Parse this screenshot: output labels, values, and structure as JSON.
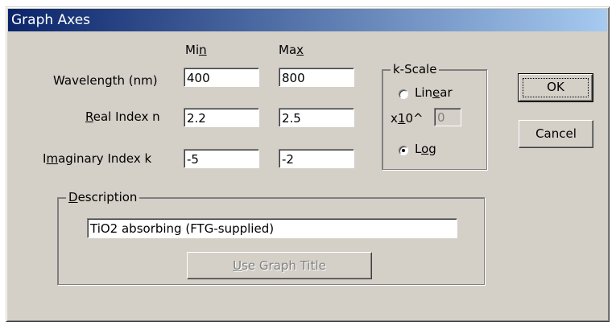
{
  "window": {
    "title": "Graph Axes"
  },
  "headers": {
    "min_pre": "Mi",
    "min_u": "n",
    "max_pre": "Ma",
    "max_u": "x"
  },
  "rows": {
    "wavelength": {
      "label": "Wavelength (nm)",
      "min": "400",
      "max": "800"
    },
    "real": {
      "u": "R",
      "rest": "eal Index n",
      "min": "2.2",
      "max": "2.5"
    },
    "imag": {
      "pre": "I",
      "u": "m",
      "rest": "aginary Index k",
      "min": "-5",
      "max": "-2"
    }
  },
  "kscale": {
    "title": "k-Scale",
    "linear": {
      "pre": "Lin",
      "u": "e",
      "rest": "ar",
      "selected": false
    },
    "x10": {
      "pre": "x",
      "u": "1",
      "rest": "0^",
      "value": "0"
    },
    "log": {
      "pre": "L",
      "u": "o",
      "rest": "g",
      "selected": true
    }
  },
  "description": {
    "title_u": "D",
    "title_rest": "escription",
    "value": "TiO2 absorbing (FTG-supplied)",
    "use_title_button": {
      "u": "U",
      "rest": "se Graph Title"
    }
  },
  "buttons": {
    "ok": "OK",
    "cancel": "Cancel"
  }
}
